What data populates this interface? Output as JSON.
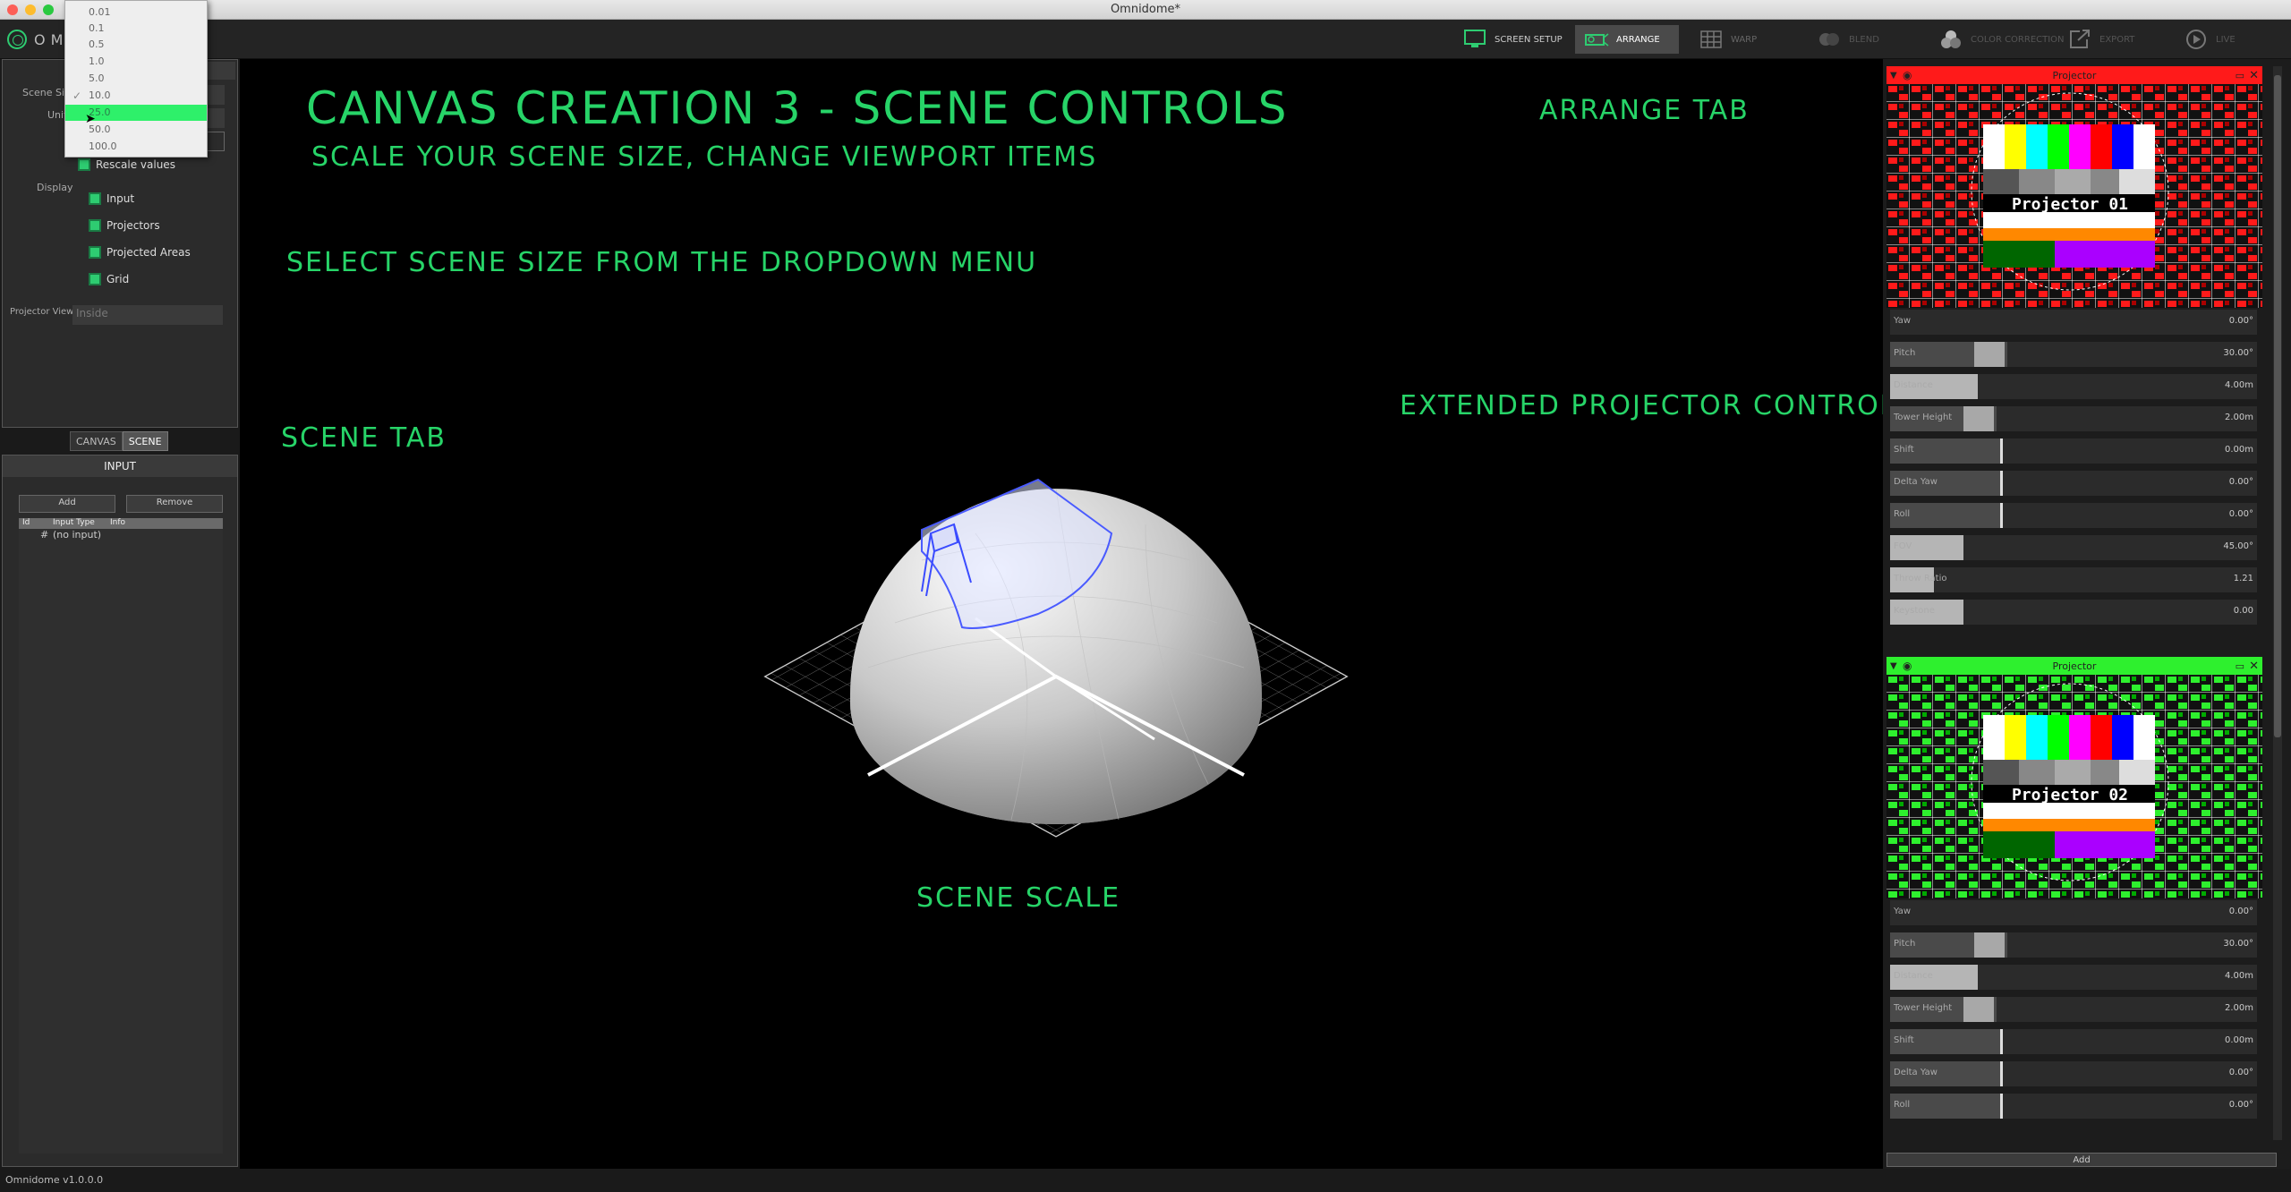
{
  "window": {
    "title": "Omnidome*"
  },
  "app": {
    "logo_text": "OMNI"
  },
  "toolbar": {
    "tabs": [
      {
        "label": "SCREEN SETUP",
        "icon": "monitor-icon"
      },
      {
        "label": "ARRANGE",
        "icon": "projector-icon",
        "active": true
      },
      {
        "label": "WARP",
        "icon": "grid-icon"
      },
      {
        "label": "BLEND",
        "icon": "blend-icon"
      },
      {
        "label": "COLOR CORRECTION",
        "icon": "color-correction-icon"
      },
      {
        "label": "EXPORT",
        "icon": "export-icon"
      },
      {
        "label": "LIVE",
        "icon": "play-icon"
      }
    ]
  },
  "scene_settings": {
    "scene_size_label": "Scene Size",
    "unit_label": "Unit",
    "rescale_label": "Rescale values",
    "display_label": "Display",
    "display_items": [
      "Input",
      "Projectors",
      "Projected Areas",
      "Grid"
    ],
    "projector_view_label": "Projector View",
    "projector_view_value": "Inside",
    "dropdown_options": [
      "0.01",
      "0.1",
      "0.5",
      "1.0",
      "5.0",
      "10.0",
      "25.0",
      "50.0",
      "100.0"
    ],
    "dropdown_checked": "10.0",
    "dropdown_highlighted": "25.0"
  },
  "left_tabs": {
    "canvas": "CANVAS",
    "scene": "SCENE"
  },
  "input_panel": {
    "title": "INPUT",
    "add_label": "Add",
    "remove_label": "Remove",
    "columns": [
      "Id",
      "Input Type",
      "Info"
    ],
    "rows": [
      {
        "id": "#",
        "type": "(no input)",
        "info": ""
      }
    ]
  },
  "annotations": {
    "heading": "CANVAS CREATION 3 - SCENE CONTROLS",
    "subheading": "SCALE YOUR SCENE SIZE, CHANGE VIEWPORT ITEMS",
    "select_scene": "SELECT SCENE SIZE FROM THE DROPDOWN MENU",
    "scene_tab": "SCENE TAB",
    "arrange_tab": "ARRANGE TAB",
    "extended": "EXTENDED PROJECTOR CONTROLS",
    "scene_scale": "SCENE SCALE"
  },
  "projectors": [
    {
      "header": "Projector",
      "label": "Projector 01",
      "color": "#ff1a1a",
      "sliders": [
        {
          "name": "Yaw",
          "value": "0.00°",
          "fill": 0.0
        },
        {
          "name": "Pitch",
          "value": "30.00°",
          "fill": 0.32
        },
        {
          "name": "Distance",
          "value": "4.00m",
          "fill": 0.24
        },
        {
          "name": "Tower Height",
          "value": "2.00m",
          "fill": 0.29
        },
        {
          "name": "Shift",
          "value": "0.00m",
          "fill": 0.3
        },
        {
          "name": "Delta Yaw",
          "value": "0.00°",
          "fill": 0.3
        },
        {
          "name": "Roll",
          "value": "0.00°",
          "fill": 0.3
        },
        {
          "name": "FOV",
          "value": "45.00°",
          "fill": 0.2
        },
        {
          "name": "Throw Ratio",
          "value": "1.21",
          "fill": 0.12
        },
        {
          "name": "Keystone",
          "value": "0.00",
          "fill": 0.2
        }
      ]
    },
    {
      "header": "Projector",
      "label": "Projector 02",
      "color": "#2ef02e",
      "sliders": [
        {
          "name": "Yaw",
          "value": "0.00°",
          "fill": 0.0
        },
        {
          "name": "Pitch",
          "value": "30.00°",
          "fill": 0.32
        },
        {
          "name": "Distance",
          "value": "4.00m",
          "fill": 0.24
        },
        {
          "name": "Tower Height",
          "value": "2.00m",
          "fill": 0.29
        },
        {
          "name": "Shift",
          "value": "0.00m",
          "fill": 0.3
        },
        {
          "name": "Delta Yaw",
          "value": "0.00°",
          "fill": 0.3
        },
        {
          "name": "Roll",
          "value": "0.00°",
          "fill": 0.3
        }
      ]
    }
  ],
  "right_panel": {
    "add_label": "Add"
  },
  "status": {
    "version": "Omnidome v1.0.0.0"
  }
}
